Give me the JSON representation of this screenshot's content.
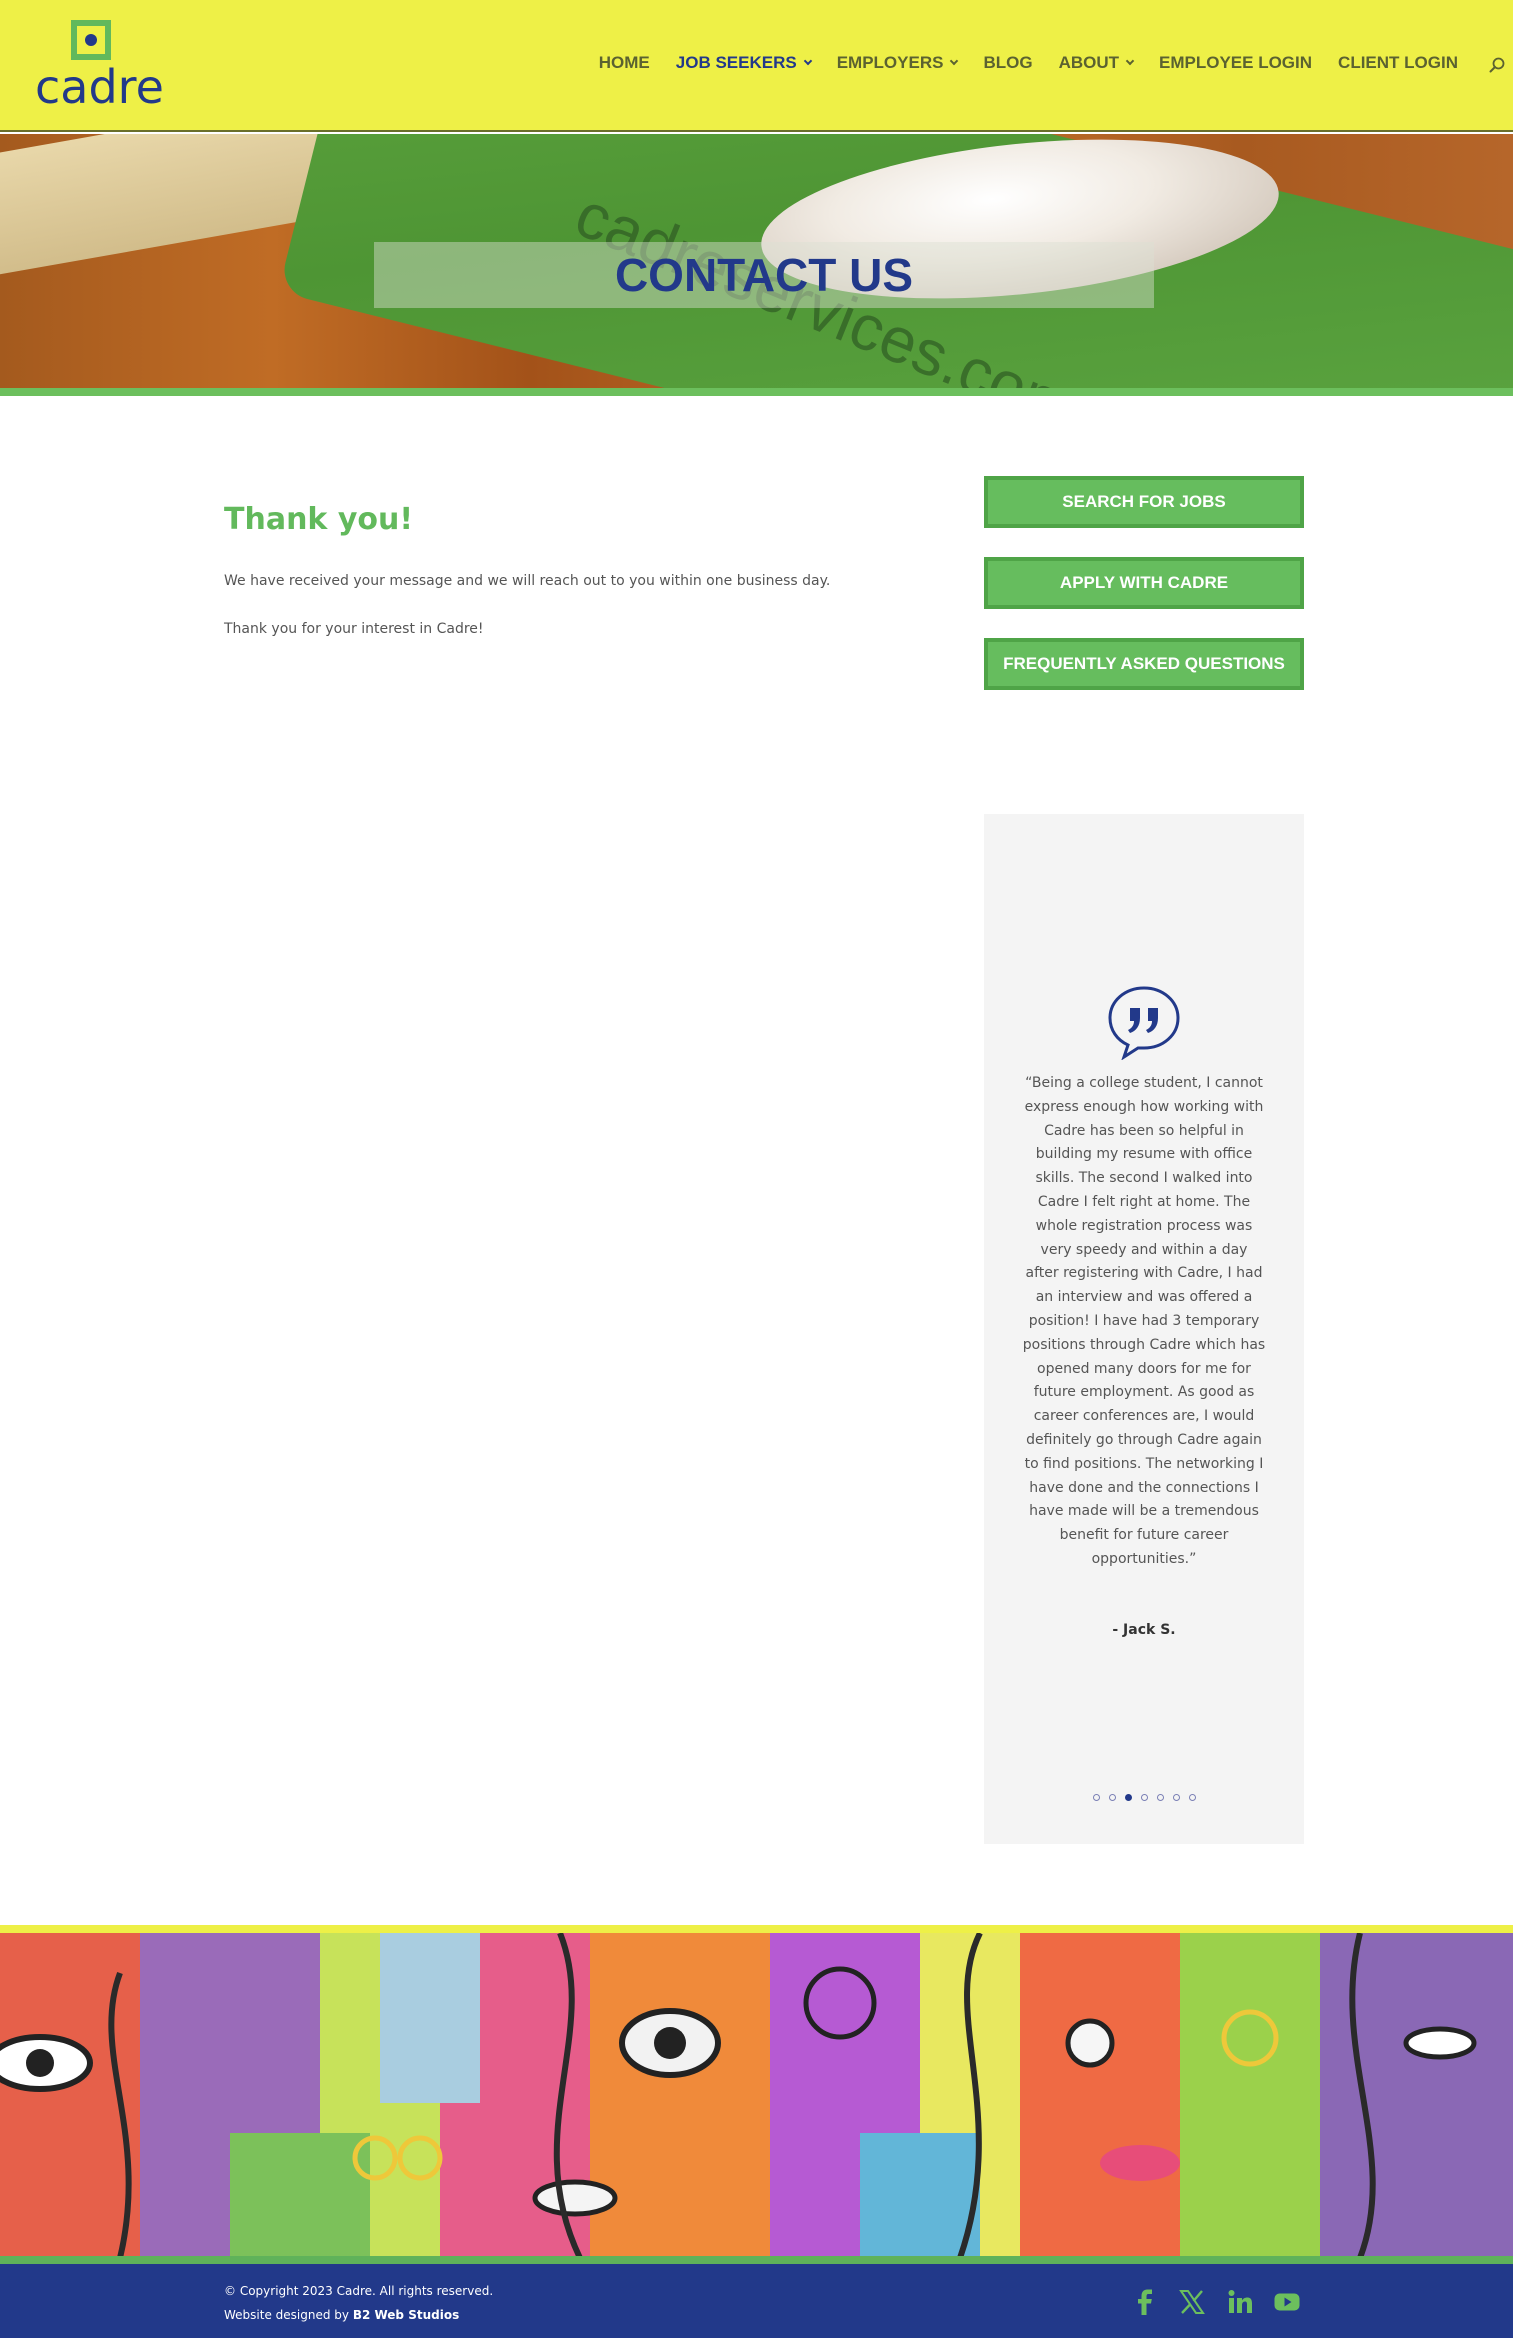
{
  "brand": {
    "name": "cadre"
  },
  "nav": {
    "items": [
      {
        "label": "HOME",
        "has_dropdown": false,
        "active": false
      },
      {
        "label": "JOB SEEKERS",
        "has_dropdown": true,
        "active": true
      },
      {
        "label": "EMPLOYERS",
        "has_dropdown": true,
        "active": false
      },
      {
        "label": "BLOG",
        "has_dropdown": false,
        "active": false
      },
      {
        "label": "ABOUT",
        "has_dropdown": true,
        "active": false
      },
      {
        "label": "EMPLOYEE LOGIN",
        "has_dropdown": false,
        "active": false
      },
      {
        "label": "CLIENT LOGIN",
        "has_dropdown": false,
        "active": false
      }
    ],
    "search_icon": "search-icon"
  },
  "hero": {
    "title": "CONTACT US",
    "pad_text": "cadreservices.com"
  },
  "main": {
    "heading": "Thank you!",
    "paragraph1": "We have received your message and we will reach out to you within one business day.",
    "paragraph2": "Thank you for your interest in Cadre!"
  },
  "sidebar": {
    "buttons": [
      {
        "label": "SEARCH FOR JOBS"
      },
      {
        "label": "APPLY WITH CADRE"
      },
      {
        "label": "FREQUENTLY ASKED QUESTIONS"
      }
    ],
    "testimonial": {
      "quote": "“Being a college student, I cannot express enough how working with Cadre has been so helpful in building my resume with office skills. The second I walked into Cadre I felt right at home. The whole registration process was very speedy and within a day after registering with Cadre, I had an interview and was offered a position! I have had 3 temporary positions through Cadre which has opened many doors for me for future employment. As good as career conferences are, I would definitely go through Cadre again to find positions. The networking I have done and the connections I have made will be a tremendous benefit for future career opportunities.”",
      "author": "- Jack S.",
      "dots_total": 7,
      "dots_active_index": 2
    }
  },
  "footer": {
    "copyright": "© Copyright 2023 Cadre. All rights reserved.",
    "designed_prefix": "Website designed by ",
    "designed_by": "B2 Web Studios",
    "social": [
      "facebook-icon",
      "x-icon",
      "linkedin-icon",
      "youtube-icon"
    ]
  },
  "colors": {
    "header_bg": "#eef047",
    "brand_blue": "#22398a",
    "brand_green": "#62b95c",
    "button_green": "#66bd5e",
    "footer_bg": "#22398a",
    "testimonial_bg": "#f4f4f4"
  }
}
